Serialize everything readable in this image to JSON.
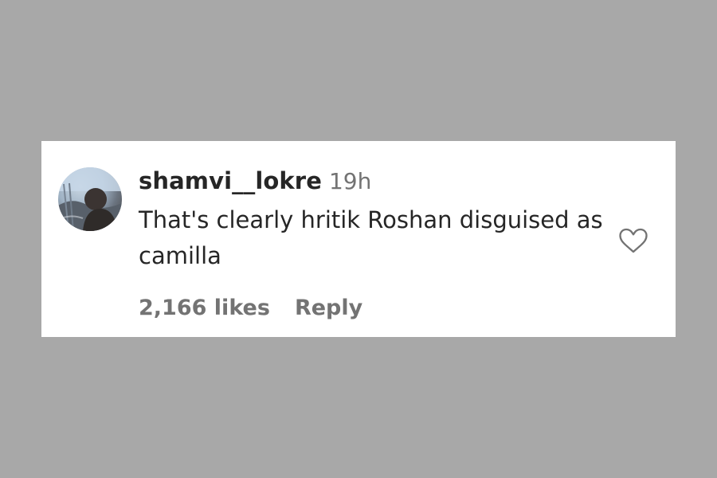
{
  "comment": {
    "username": "shamvi__lokre",
    "timestamp": "19h",
    "text": "That's clearly hritik Roshan disguised as camilla",
    "likes": "2,166 likes",
    "reply_label": "Reply",
    "icons": {
      "like": "heart-icon"
    }
  },
  "colors": {
    "background": "#a8a8a8",
    "card": "#ffffff",
    "primary_text": "#262626",
    "secondary_text": "#737373"
  }
}
